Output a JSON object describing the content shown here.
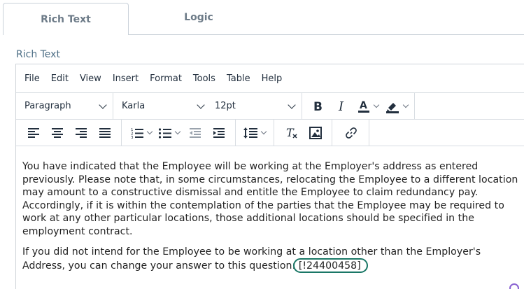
{
  "tabs": [
    {
      "label": "Rich Text",
      "active": true
    },
    {
      "label": "Logic",
      "active": false
    }
  ],
  "field_label": "Rich Text",
  "menubar": [
    "File",
    "Edit",
    "View",
    "Insert",
    "Format",
    "Tools",
    "Table",
    "Help"
  ],
  "toolbar": {
    "block_format": "Paragraph",
    "font_family": "Karla",
    "font_size": "12pt"
  },
  "icons": [
    "bold-icon",
    "italic-icon",
    "text-color-icon",
    "highlight-icon",
    "align-left-icon",
    "align-center-icon",
    "align-right-icon",
    "align-justify-icon",
    "numbered-list-icon",
    "bullet-list-icon",
    "outdent-icon",
    "indent-icon",
    "line-height-icon",
    "clear-format-icon",
    "image-icon",
    "link-icon"
  ],
  "content": {
    "paragraph1": "You have indicated that the Employee will be working at the Employer's address as entered previously. Please note that, in some circumstances, relocating the Employee to a different location may amount to a constructive dismissal and entitle the Employee to claim redundancy pay. Accordingly, if it is within the contemplation of the parties that the Employee may be required to work at any other particular locations, those additional locations should be specified in the employment contract.",
    "paragraph2": "If you did not intend for the Employee to be working at a location other than the Employer's Address, you can change your answer to this question:",
    "token": "[!24400458]"
  },
  "colors": {
    "accent_token": "#1a7766",
    "label": "#4e6f86",
    "tab_text": "#6d7b88"
  }
}
